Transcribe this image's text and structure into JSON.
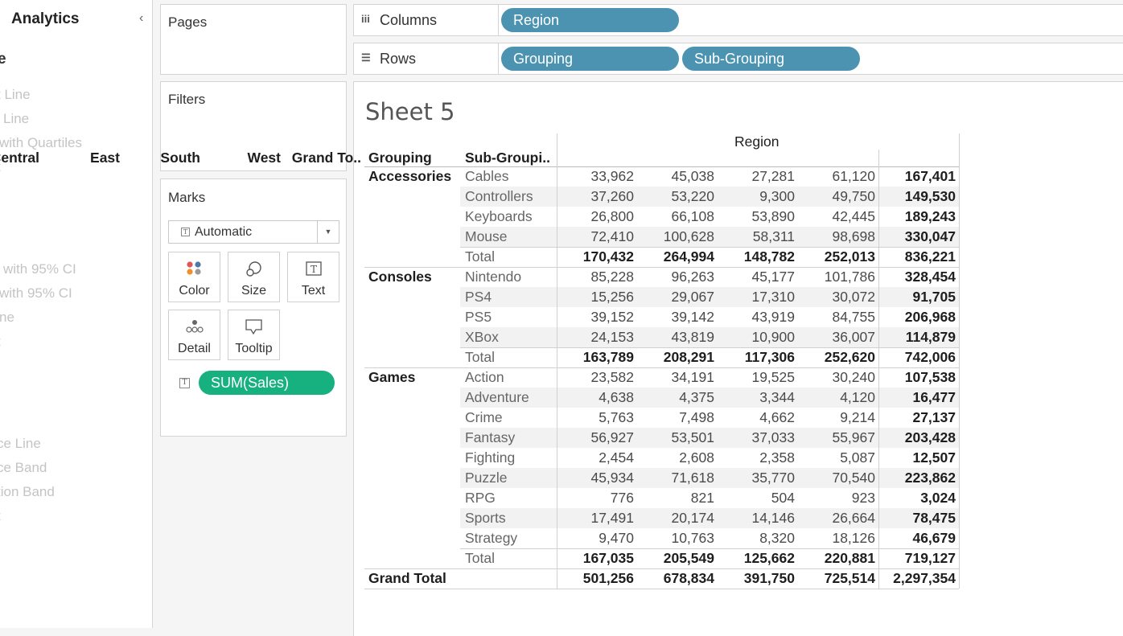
{
  "analytics": {
    "title": "Analytics",
    "section_fragment": "e",
    "items": [
      "t Line",
      "Line",
      "with Quartiles",
      "t",
      "with 95% CI",
      "with 95% CI",
      "ne",
      "t",
      "ce Line",
      "ce Band",
      "tion Band",
      "t"
    ]
  },
  "pages": {
    "label": "Pages"
  },
  "filters": {
    "label": "Filters"
  },
  "marks": {
    "label": "Marks",
    "type": "Automatic",
    "buttons": [
      "Color",
      "Size",
      "Text",
      "Detail",
      "Tooltip"
    ],
    "pill": "SUM(Sales)"
  },
  "columns_shelf": {
    "label": "Columns",
    "pills": [
      "Region"
    ]
  },
  "rows_shelf": {
    "label": "Rows",
    "pills": [
      "Grouping",
      "Sub-Grouping"
    ]
  },
  "sheet": {
    "title": "Sheet 5",
    "region_header": "Region",
    "headers": {
      "grouping": "Grouping",
      "subgrouping": "Sub-Groupi..",
      "central": "Central",
      "east": "East",
      "south": "South",
      "west": "West",
      "grand": "Grand To.."
    },
    "groups": [
      {
        "name": "Accessories",
        "rows": [
          [
            "Cables",
            "33,962",
            "45,038",
            "27,281",
            "61,120",
            "167,401"
          ],
          [
            "Controllers",
            "37,260",
            "53,220",
            "9,300",
            "49,750",
            "149,530"
          ],
          [
            "Keyboards",
            "26,800",
            "66,108",
            "53,890",
            "42,445",
            "189,243"
          ],
          [
            "Mouse",
            "72,410",
            "100,628",
            "58,311",
            "98,698",
            "330,047"
          ],
          [
            "Total",
            "170,432",
            "264,994",
            "148,782",
            "252,013",
            "836,221"
          ]
        ]
      },
      {
        "name": "Consoles",
        "rows": [
          [
            "Nintendo",
            "85,228",
            "96,263",
            "45,177",
            "101,786",
            "328,454"
          ],
          [
            "PS4",
            "15,256",
            "29,067",
            "17,310",
            "30,072",
            "91,705"
          ],
          [
            "PS5",
            "39,152",
            "39,142",
            "43,919",
            "84,755",
            "206,968"
          ],
          [
            "XBox",
            "24,153",
            "43,819",
            "10,900",
            "36,007",
            "114,879"
          ],
          [
            "Total",
            "163,789",
            "208,291",
            "117,306",
            "252,620",
            "742,006"
          ]
        ]
      },
      {
        "name": "Games",
        "rows": [
          [
            "Action",
            "23,582",
            "34,191",
            "19,525",
            "30,240",
            "107,538"
          ],
          [
            "Adventure",
            "4,638",
            "4,375",
            "3,344",
            "4,120",
            "16,477"
          ],
          [
            "Crime",
            "5,763",
            "7,498",
            "4,662",
            "9,214",
            "27,137"
          ],
          [
            "Fantasy",
            "56,927",
            "53,501",
            "37,033",
            "55,967",
            "203,428"
          ],
          [
            "Fighting",
            "2,454",
            "2,608",
            "2,358",
            "5,087",
            "12,507"
          ],
          [
            "Puzzle",
            "45,934",
            "71,618",
            "35,770",
            "70,540",
            "223,862"
          ],
          [
            "RPG",
            "776",
            "821",
            "504",
            "923",
            "3,024"
          ],
          [
            "Sports",
            "17,491",
            "20,174",
            "14,146",
            "26,664",
            "78,475"
          ],
          [
            "Strategy",
            "9,470",
            "10,763",
            "8,320",
            "18,126",
            "46,679"
          ],
          [
            "Total",
            "167,035",
            "205,549",
            "125,662",
            "220,881",
            "719,127"
          ]
        ]
      }
    ],
    "grand_total": [
      "Grand Total",
      "501,256",
      "678,834",
      "391,750",
      "725,514",
      "2,297,354"
    ]
  },
  "colors": {
    "dimension_pill": "#4b93b1",
    "measure_pill": "#17b17f"
  }
}
